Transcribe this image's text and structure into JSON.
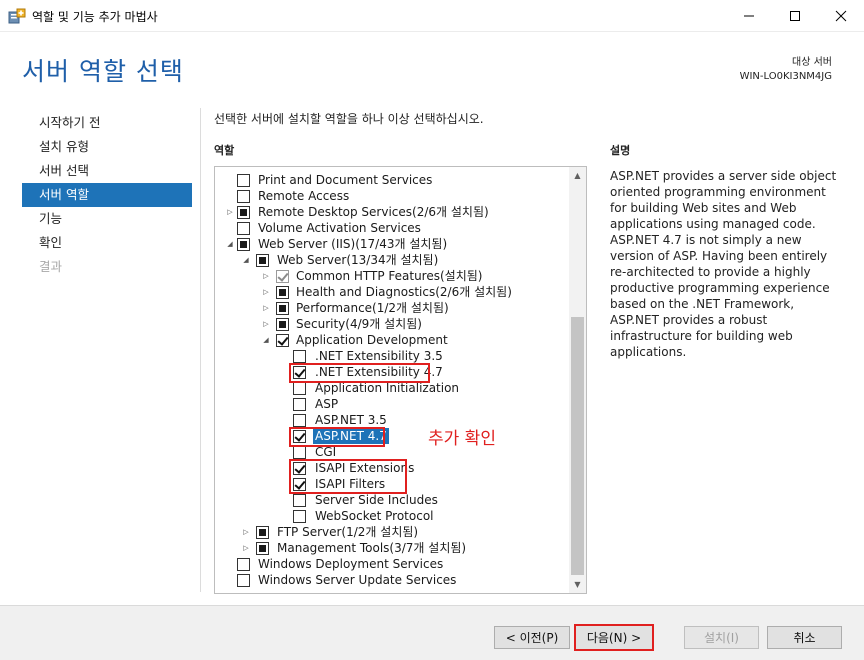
{
  "window": {
    "title": "역할 및 기능 추가 마법사",
    "controls": {
      "minimize": "minimize-icon",
      "maximize": "maximize-icon",
      "close": "close-icon"
    }
  },
  "header": {
    "title": "서버 역할 선택",
    "target_label": "대상 서버",
    "target_server": "WIN-LO0KI3NM4JG"
  },
  "nav": {
    "items": [
      {
        "label": "시작하기 전",
        "state": "normal"
      },
      {
        "label": "설치 유형",
        "state": "normal"
      },
      {
        "label": "서버 선택",
        "state": "normal"
      },
      {
        "label": "서버 역할",
        "state": "active"
      },
      {
        "label": "기능",
        "state": "normal"
      },
      {
        "label": "확인",
        "state": "normal"
      },
      {
        "label": "결과",
        "state": "disabled"
      }
    ]
  },
  "main": {
    "instruction": "선택한 서버에 설치할 역할을 하나 이상 선택하십시오.",
    "roles_header": "역할",
    "description_header": "설명",
    "description": "ASP.NET provides a server side object oriented programming environment for building Web sites and Web applications using managed code. ASP.NET 4.7 is not simply a new version of ASP. Having been entirely re-architected to provide a highly productive programming experience based on the .NET Framework, ASP.NET provides a robust infrastructure for building web applications.",
    "roles": [
      {
        "label": "Print and Document Services",
        "level": 0,
        "expander": "none",
        "state": "unchecked"
      },
      {
        "label": "Remote Access",
        "level": 0,
        "expander": "none",
        "state": "unchecked"
      },
      {
        "label": "Remote Desktop Services(2/6개 설치됨)",
        "level": 0,
        "expander": "collapsed",
        "state": "partial"
      },
      {
        "label": "Volume Activation Services",
        "level": 0,
        "expander": "none",
        "state": "unchecked"
      },
      {
        "label": "Web Server (IIS)(17/43개 설치됨)",
        "level": 0,
        "expander": "expanded",
        "state": "partial"
      },
      {
        "label": "Web Server(13/34개 설치됨)",
        "level": 1,
        "expander": "expanded",
        "state": "partial"
      },
      {
        "label": "Common HTTP Features(설치됨)",
        "level": 2,
        "expander": "collapsed",
        "state": "checked-dim"
      },
      {
        "label": "Health and Diagnostics(2/6개 설치됨)",
        "level": 2,
        "expander": "collapsed",
        "state": "partial"
      },
      {
        "label": "Performance(1/2개 설치됨)",
        "level": 2,
        "expander": "collapsed",
        "state": "partial"
      },
      {
        "label": "Security(4/9개 설치됨)",
        "level": 2,
        "expander": "collapsed",
        "state": "partial"
      },
      {
        "label": "Application Development",
        "level": 2,
        "expander": "expanded",
        "state": "checked"
      },
      {
        "label": ".NET Extensibility 3.5",
        "level": 3,
        "expander": "none",
        "state": "unchecked"
      },
      {
        "label": ".NET Extensibility 4.7",
        "level": 3,
        "expander": "none",
        "state": "checked"
      },
      {
        "label": "Application Initialization",
        "level": 3,
        "expander": "none",
        "state": "unchecked"
      },
      {
        "label": "ASP",
        "level": 3,
        "expander": "none",
        "state": "unchecked"
      },
      {
        "label": "ASP.NET 3.5",
        "level": 3,
        "expander": "none",
        "state": "unchecked"
      },
      {
        "label": "ASP.NET 4.7",
        "level": 3,
        "expander": "none",
        "state": "checked",
        "selected": true
      },
      {
        "label": "CGI",
        "level": 3,
        "expander": "none",
        "state": "unchecked"
      },
      {
        "label": "ISAPI Extensions",
        "level": 3,
        "expander": "none",
        "state": "checked"
      },
      {
        "label": "ISAPI Filters",
        "level": 3,
        "expander": "none",
        "state": "checked"
      },
      {
        "label": "Server Side Includes",
        "level": 3,
        "expander": "none",
        "state": "unchecked"
      },
      {
        "label": "WebSocket Protocol",
        "level": 3,
        "expander": "none",
        "state": "unchecked"
      },
      {
        "label": "FTP Server(1/2개 설치됨)",
        "level": 1,
        "expander": "collapsed",
        "state": "partial"
      },
      {
        "label": "Management Tools(3/7개 설치됨)",
        "level": 1,
        "expander": "collapsed",
        "state": "partial"
      },
      {
        "label": "Windows Deployment Services",
        "level": 0,
        "expander": "none",
        "state": "unchecked"
      },
      {
        "label": "Windows Server Update Services",
        "level": 0,
        "expander": "none",
        "state": "unchecked"
      }
    ]
  },
  "annotation": {
    "text": "추가 확인",
    "color": "#e0201f"
  },
  "footer": {
    "prev_label": "< 이전(P)",
    "next_label": "다음(N) >",
    "install_label": "설치(I)",
    "cancel_label": "취소"
  },
  "colors": {
    "accent": "#1e73b8",
    "heading": "#1f5fa9",
    "highlight": "#e0201f"
  }
}
